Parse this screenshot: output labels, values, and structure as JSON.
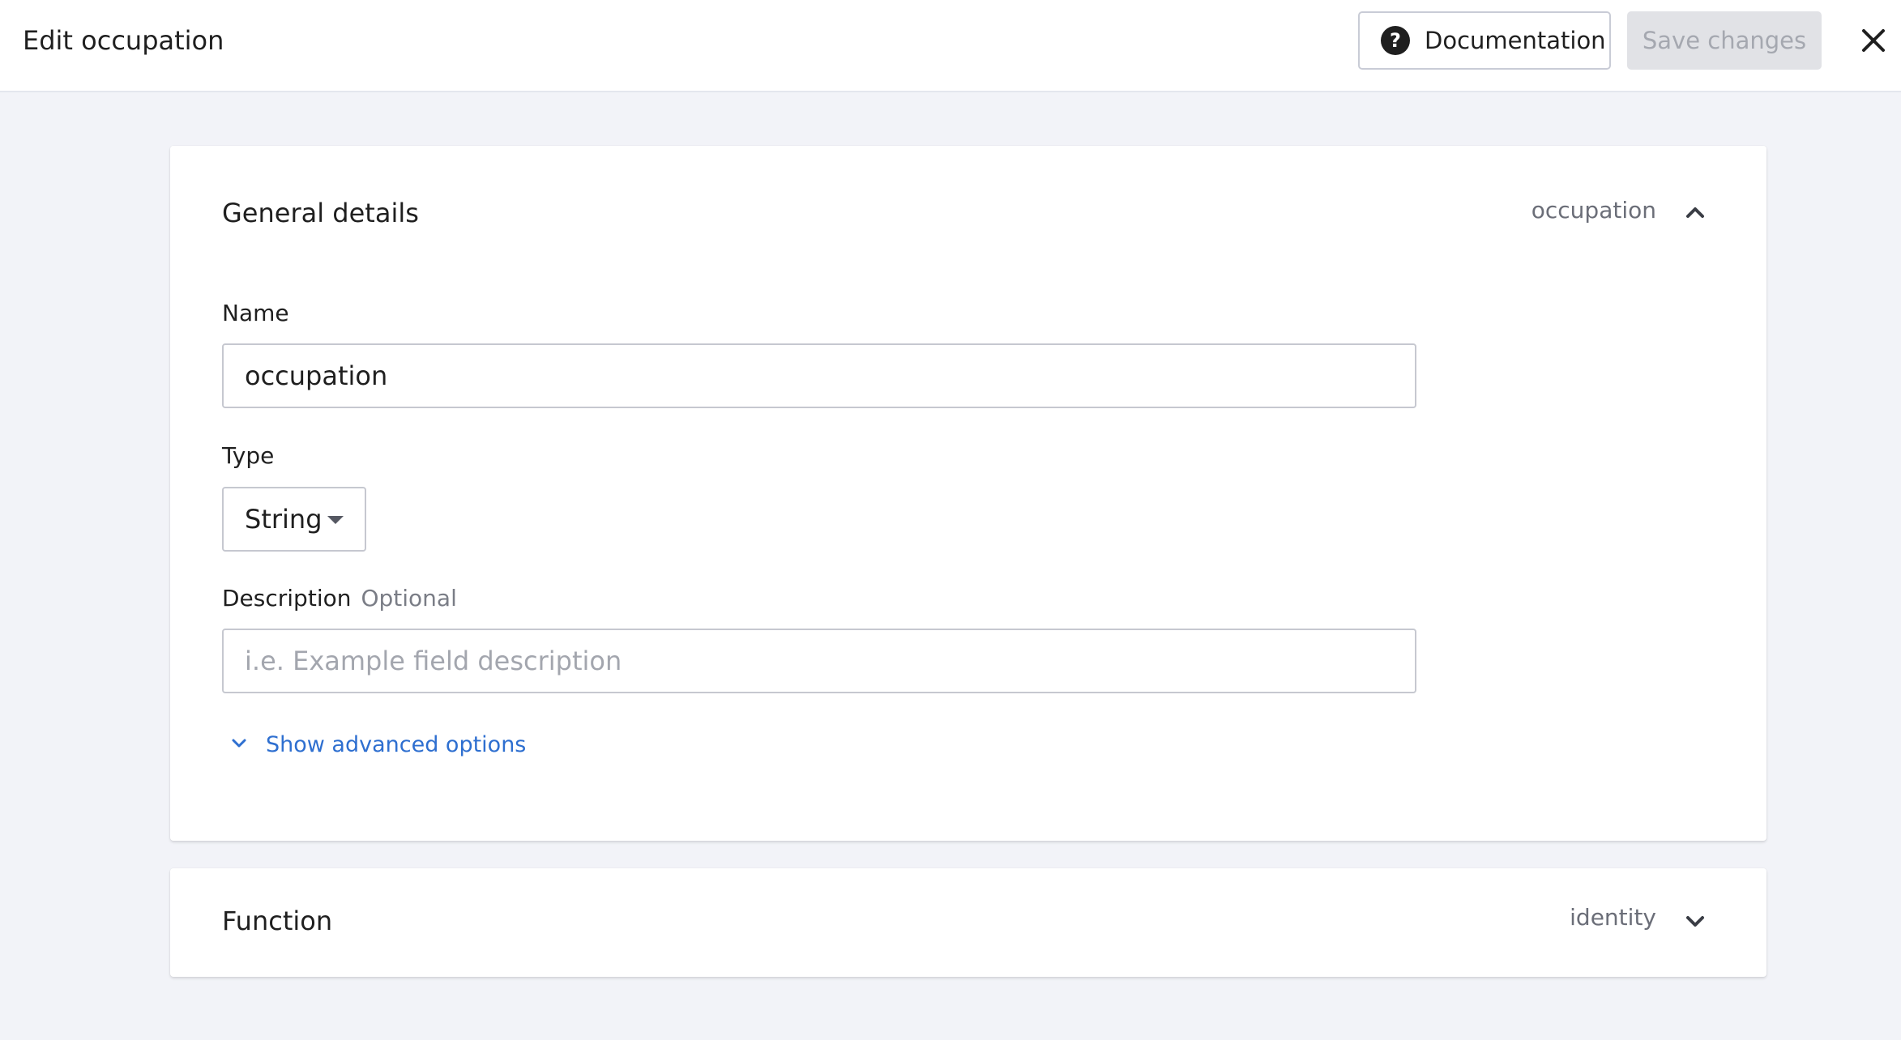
{
  "header": {
    "title": "Edit occupation",
    "documentation_label": "Documentation",
    "save_label": "Save changes"
  },
  "general": {
    "title": "General details",
    "meta": "occupation",
    "name_label": "Name",
    "name_value": "occupation",
    "type_label": "Type",
    "type_value": "String",
    "description_label": "Description",
    "description_optional": "Optional",
    "description_placeholder": "i.e. Example field description",
    "advanced_label": "Show advanced options"
  },
  "function": {
    "title": "Function",
    "meta": "identity"
  },
  "colors": {
    "accent": "#2e6fd0",
    "page_background": "#f2f3f8",
    "disabled_button": "#e1e2e6"
  },
  "icons": {
    "help": "help-circle-icon",
    "close": "close-icon",
    "collapse": "chevron-up-icon",
    "expand": "chevron-down-icon"
  }
}
